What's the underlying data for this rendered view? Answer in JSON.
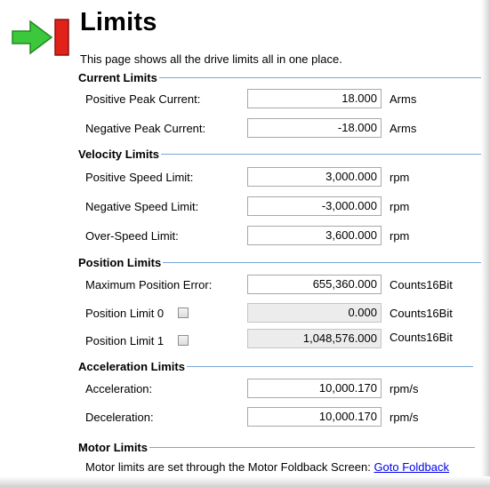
{
  "header": {
    "title": "Limits",
    "description": "This page shows all the drive limits all in one place."
  },
  "colors": {
    "arrow_green": "#3cc83c",
    "bar_red": "#e0221a",
    "link": "#0000ee",
    "rule_blue": "#7aa6d6"
  },
  "current_limits": {
    "heading": "Current Limits",
    "positive_peak": {
      "label": "Positive Peak Current:",
      "value": "18.000",
      "unit": "Arms"
    },
    "negative_peak": {
      "label": "Negative Peak Current:",
      "value": "-18.000",
      "unit": "Arms"
    }
  },
  "velocity_limits": {
    "heading": "Velocity Limits",
    "positive_speed": {
      "label": "Positive Speed Limit:",
      "value": "3,000.000",
      "unit": "rpm"
    },
    "negative_speed": {
      "label": "Negative Speed Limit:",
      "value": "-3,000.000",
      "unit": "rpm"
    },
    "over_speed": {
      "label": "Over-Speed Limit:",
      "value": "3,600.000",
      "unit": "rpm"
    }
  },
  "position_limits": {
    "heading": "Position Limits",
    "max_position_error": {
      "label": "Maximum Position Error:",
      "value": "655,360.000",
      "unit": "Counts16Bit"
    },
    "position_limit_0": {
      "label": "Position Limit 0",
      "value": "0.000",
      "unit": "Counts16Bit",
      "checked": false
    },
    "position_limit_1": {
      "label": "Position Limit 1",
      "value": "1,048,576.000",
      "unit": "Counts16Bit",
      "checked": false
    }
  },
  "acceleration_limits": {
    "heading": "Acceleration Limits",
    "acceleration": {
      "label": "Acceleration:",
      "value": "10,000.170",
      "unit": "rpm/s"
    },
    "deceleration": {
      "label": "Deceleration:",
      "value": "10,000.170",
      "unit": "rpm/s"
    }
  },
  "motor_limits": {
    "heading": "Motor Limits",
    "note": "Motor limits are set through the Motor Foldback Screen:",
    "link": "Goto Foldback"
  }
}
